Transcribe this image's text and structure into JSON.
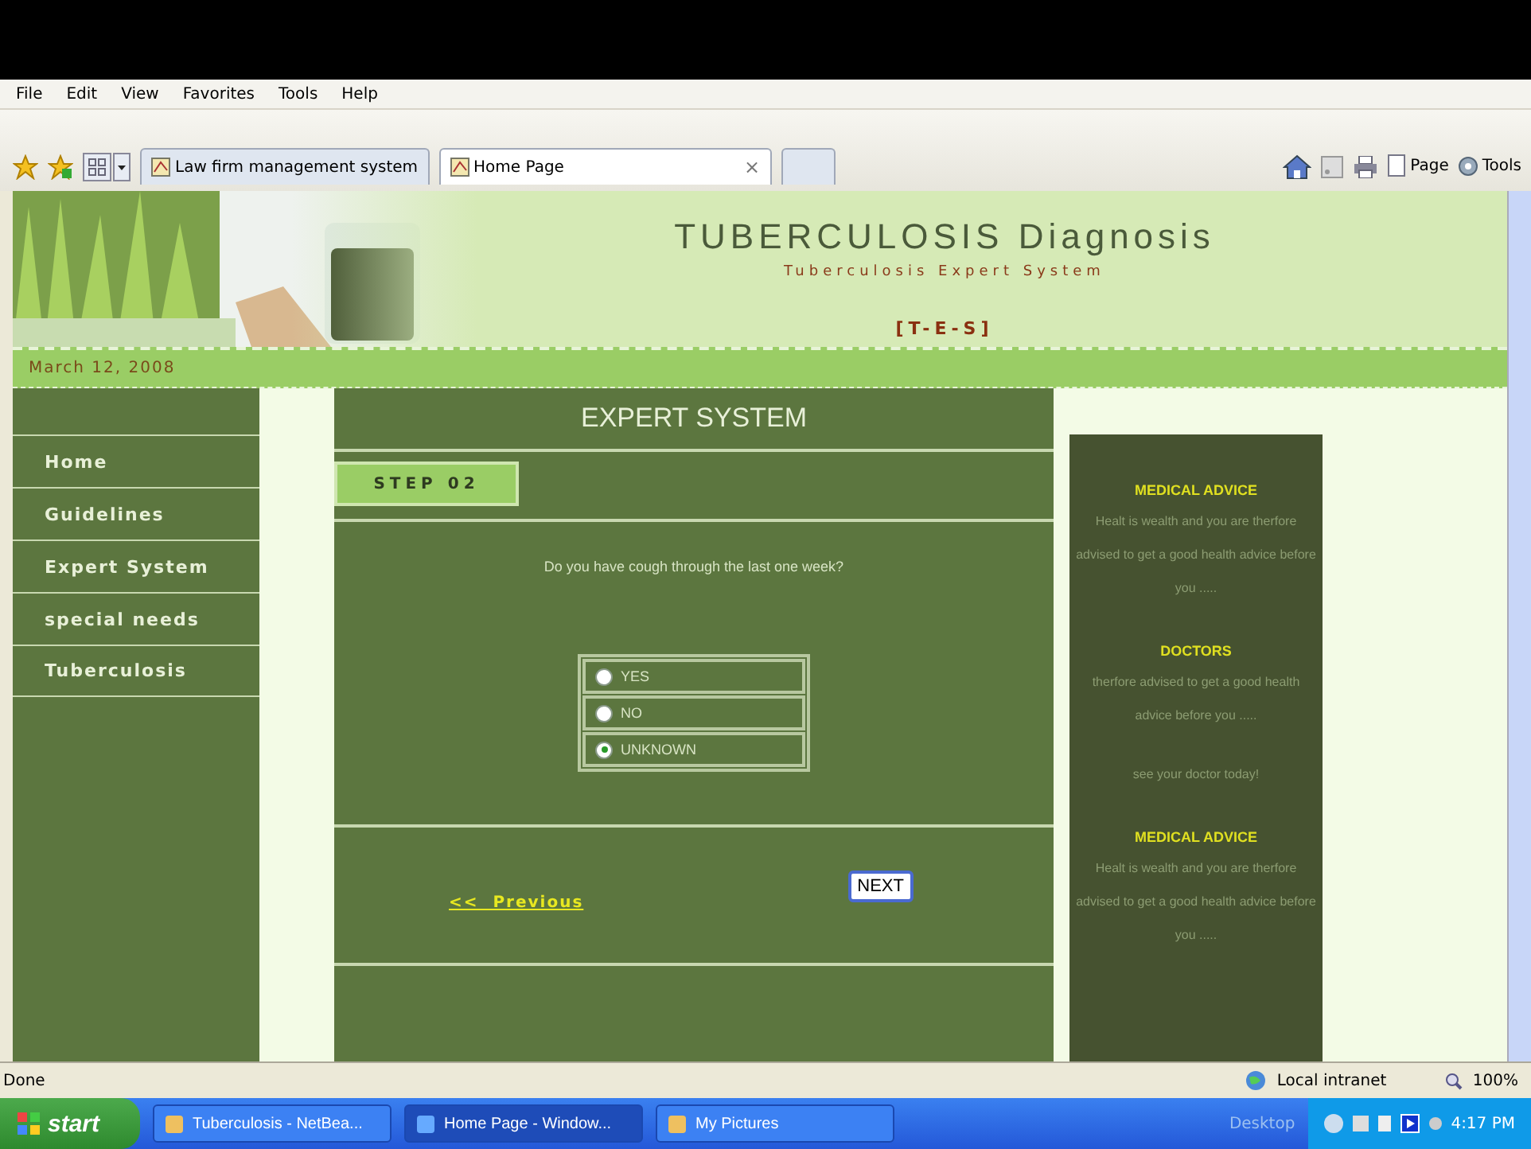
{
  "browser": {
    "menu": [
      "File",
      "Edit",
      "View",
      "Favorites",
      "Tools",
      "Help"
    ],
    "tabs": [
      {
        "label": "Law firm management system",
        "selected": false
      },
      {
        "label": "Home Page",
        "selected": true
      }
    ],
    "tab_close": "×",
    "tools": [
      "Page",
      "Tools"
    ],
    "status": "Done",
    "zone": "Local intranet",
    "zoom": "100%"
  },
  "page": {
    "title": "TUBERCULOSIS Diagnosis",
    "subtitle": "Tuberculosis Expert System",
    "code": "[T-E-S]",
    "date": "March 12, 2008",
    "nav": [
      "Home",
      "Guidelines",
      "Expert System",
      "special needs",
      "Tuberculosis"
    ],
    "panel_title": "EXPERT SYSTEM",
    "step": "STEP 02",
    "question": "Do you have cough through the last one week?",
    "options": [
      {
        "label": "YES",
        "selected": false
      },
      {
        "label": "NO",
        "selected": false
      },
      {
        "label": "UNKNOWN",
        "selected": true
      }
    ],
    "previous": "<<  Previous",
    "next": "NEXT",
    "sidebar": [
      {
        "kind": "heading",
        "text": "MEDICAL ADVICE"
      },
      {
        "kind": "text",
        "text": "Healt is wealth and you are therfore advised to get a good health advice before you ....."
      },
      {
        "kind": "heading",
        "text": "DOCTORS"
      },
      {
        "kind": "text",
        "text": "therfore advised to get a good health advice before you ....."
      },
      {
        "kind": "text",
        "text": "see your doctor today!"
      },
      {
        "kind": "heading",
        "text": "MEDICAL ADVICE"
      },
      {
        "kind": "text",
        "text": "Healt is wealth and you are therfore advised to get a good health advice before you ....."
      }
    ]
  },
  "taskbar": {
    "start": "start",
    "tasks": [
      {
        "label": "Tuberculosis - NetBea...",
        "selected": false
      },
      {
        "label": "Home Page - Window...",
        "selected": true
      },
      {
        "label": "My Pictures",
        "selected": false
      }
    ],
    "desktop": "Desktop",
    "clock": "4:17 PM"
  }
}
